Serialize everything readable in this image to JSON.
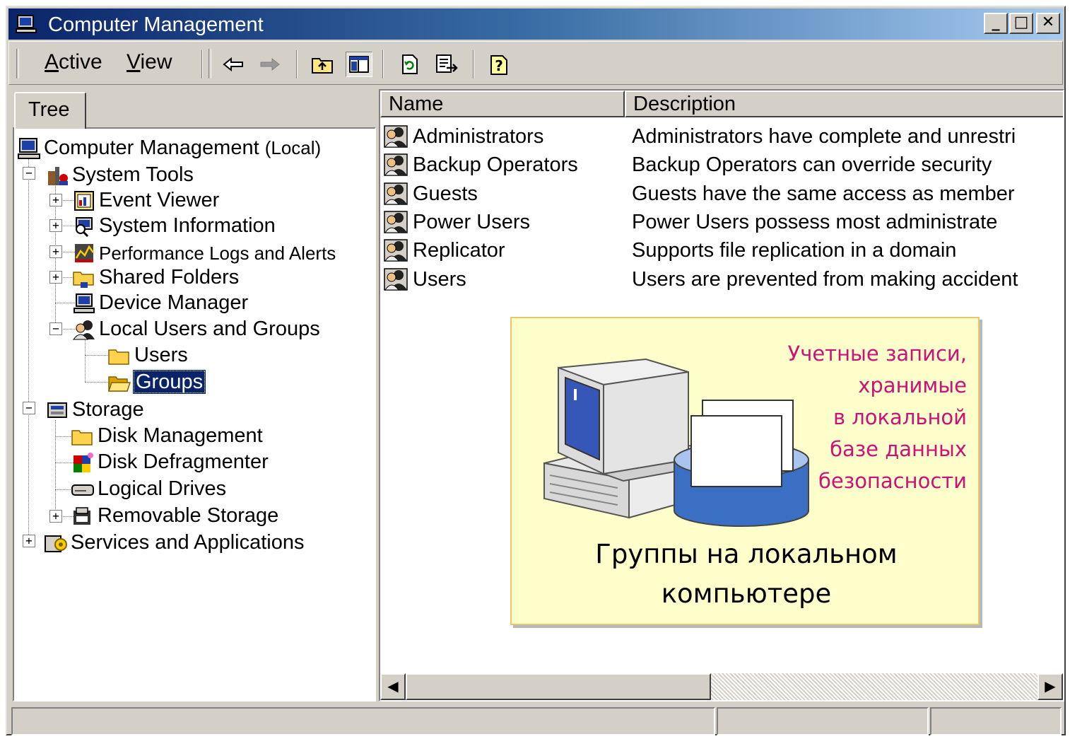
{
  "window": {
    "title": "Computer Management",
    "controls": {
      "minimize": "_",
      "maximize": "□",
      "close": "✕"
    }
  },
  "menu": {
    "action_label": "Active",
    "action_underline": "A",
    "action_rest": "ctive",
    "view_label": "View",
    "view_underline": "V",
    "view_rest": "iew"
  },
  "toolbar": {
    "icons": [
      "back-arrow-icon",
      "forward-arrow-icon",
      "up-folder-icon",
      "show-hide-tree-icon",
      "refresh-icon",
      "export-list-icon",
      "help-icon"
    ]
  },
  "left_pane": {
    "tab_label": "Tree",
    "tree": {
      "root_label": "Computer Management",
      "root_suffix": "(Local)",
      "system_tools": "System Tools",
      "event_viewer": "Event Viewer",
      "system_information": "System Information",
      "performance_logs": "Performance Logs and Alerts",
      "shared_folders": "Shared Folders",
      "device_manager": "Device Manager",
      "local_users_groups": "Local Users and Groups",
      "users": "Users",
      "groups": "Groups",
      "storage": "Storage",
      "disk_management": "Disk Management",
      "disk_defragmenter": "Disk Defragmenter",
      "logical_drives": "Logical Drives",
      "removable_storage": "Removable Storage",
      "services_applications": "Services and Applications"
    }
  },
  "right_pane": {
    "columns": {
      "name": "Name",
      "description": "Description"
    },
    "rows": [
      {
        "name": "Administrators",
        "description": "Administrators have complete and unrestri"
      },
      {
        "name": "Backup Operators",
        "description": "Backup Operators can override security"
      },
      {
        "name": "Guests",
        "description": "Guests have the same access as member"
      },
      {
        "name": "Power Users",
        "description": "Power Users possess most administrate"
      },
      {
        "name": "Replicator",
        "description": "Supports file replication in a domain"
      },
      {
        "name": "Users",
        "description": "Users are prevented from making accident"
      }
    ]
  },
  "callout": {
    "note_lines": [
      "Учетные записи,",
      "хранимые",
      "в локальной",
      "базе данных",
      "безопасности"
    ],
    "caption_lines": [
      "Группы на локальном",
      "компьютере"
    ],
    "note_color": "#cc1177",
    "background": "#ffffcc"
  },
  "colors": {
    "titlebar_start": "#0a246a",
    "titlebar_end": "#a6caf0",
    "selection": "#0a246a",
    "chrome": "#d4d0c8"
  }
}
